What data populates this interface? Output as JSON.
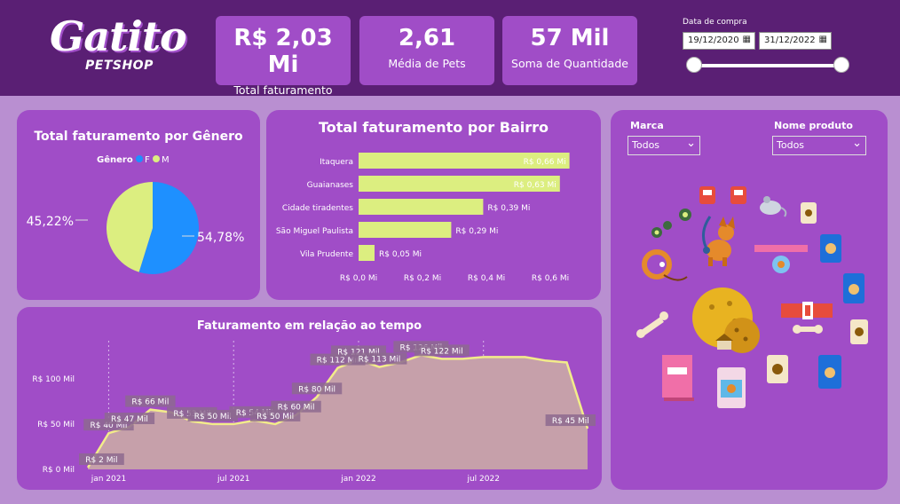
{
  "logo": {
    "main": "Gatito",
    "sub": "PETSHOP"
  },
  "kpis": [
    {
      "value": "R$ 2,03 Mi",
      "label": "Total faturamento"
    },
    {
      "value": "2,61",
      "label": "Média de Pets"
    },
    {
      "value": "57 Mil",
      "label": "Soma de Quantidade"
    }
  ],
  "date_filter": {
    "title": "Data de compra",
    "start": "19/12/2020",
    "end": "31/12/2022",
    "range_selected": [
      0,
      1
    ]
  },
  "filters": {
    "marca": {
      "label": "Marca",
      "selected": "Todos"
    },
    "produto": {
      "label": "Nome produto",
      "selected": "Todos"
    }
  },
  "colors": {
    "header": "#5a1f74",
    "card": "#a04dc7",
    "background": "#b98fd1",
    "accent_green": "#dcee80",
    "accent_blue": "#1e90ff",
    "area_line": "#f2ec8a"
  },
  "chart_data": [
    {
      "type": "pie",
      "title": "Total faturamento por Gênero",
      "legend_title": "Gênero",
      "legend_position": "top-center",
      "slices": [
        {
          "name": "F",
          "value": 54.78,
          "label": "54,78%",
          "color": "#1e90ff"
        },
        {
          "name": "M",
          "value": 45.22,
          "label": "45,22%",
          "color": "#dcee80"
        }
      ]
    },
    {
      "type": "bar",
      "orientation": "horizontal",
      "title": "Total faturamento por Bairro",
      "categories": [
        "Itaquera",
        "Guaianases",
        "Cidade tiradentes",
        "São Miguel Paulista",
        "Vila Prudente"
      ],
      "values": [
        0.66,
        0.63,
        0.39,
        0.29,
        0.05
      ],
      "value_labels": [
        "R$ 0,66 Mi",
        "R$ 0,63 Mi",
        "R$ 0,39 Mi",
        "R$ 0,29 Mi",
        "R$ 0,05 Mi"
      ],
      "xlim": [
        0,
        0.7
      ],
      "ticks": [
        0,
        0.2,
        0.4,
        0.6
      ],
      "tick_labels": [
        "R$ 0,0 Mi",
        "R$ 0,2 Mi",
        "R$ 0,4 Mi",
        "R$ 0,6 Mi"
      ],
      "color": "#dcee80"
    },
    {
      "type": "area",
      "title": "Faturamento em relação ao tempo",
      "x": [
        "2020-12-19",
        "2021-01-01",
        "2021-02-01",
        "2021-03-01",
        "2021-04-01",
        "2021-05-01",
        "2021-06-01",
        "2021-07-01",
        "2021-08-01",
        "2021-09-01",
        "2021-10-01",
        "2021-11-01",
        "2021-12-01",
        "2022-01-01",
        "2022-02-01",
        "2022-03-01",
        "2022-04-01",
        "2022-05-01",
        "2022-06-01",
        "2022-07-01",
        "2022-08-01",
        "2022-09-01",
        "2022-10-01",
        "2022-11-01",
        "2022-12-01"
      ],
      "values": [
        2,
        40,
        47,
        66,
        63,
        53,
        50,
        50,
        54,
        50,
        60,
        80,
        112,
        121,
        113,
        118,
        126,
        122,
        122,
        124,
        124,
        124,
        120,
        118,
        45
      ],
      "point_labels": [
        {
          "index": 0,
          "text": "R$ 2 Mil"
        },
        {
          "index": 1,
          "text": "R$ 40 Mil"
        },
        {
          "index": 2,
          "text": "R$ 47 Mil"
        },
        {
          "index": 3,
          "text": "R$ 66 Mil"
        },
        {
          "index": 5,
          "text": "R$ 53 Mil"
        },
        {
          "index": 6,
          "text": "R$ 50 Mil"
        },
        {
          "index": 8,
          "text": "R$ 54 Mil"
        },
        {
          "index": 9,
          "text": "R$ 50 Mil"
        },
        {
          "index": 10,
          "text": "R$ 60 Mil"
        },
        {
          "index": 11,
          "text": "R$ 80 Mil"
        },
        {
          "index": 12,
          "text": "R$ 112 Mil"
        },
        {
          "index": 13,
          "text": "R$ 121 Mil"
        },
        {
          "index": 14,
          "text": "R$ 113 Mil"
        },
        {
          "index": 16,
          "text": "R$ 126 Mil"
        },
        {
          "index": 17,
          "text": "R$ 122 Mil"
        },
        {
          "index": 24,
          "text": "R$ 45 Mil"
        }
      ],
      "ylim": [
        0,
        140
      ],
      "y_ticks": [
        0,
        50,
        100
      ],
      "y_tick_labels": [
        "R$ 0 Mil",
        "R$ 50 Mil",
        "R$ 100 Mil"
      ],
      "x_ticks": [
        {
          "index": 1,
          "label": "jan 2021"
        },
        {
          "index": 7,
          "label": "jul 2021"
        },
        {
          "index": 13,
          "label": "jan 2022"
        },
        {
          "index": 19,
          "label": "jul 2022"
        }
      ],
      "line_color": "#f2ec8a",
      "fill_color": "#c6a0aa"
    }
  ]
}
